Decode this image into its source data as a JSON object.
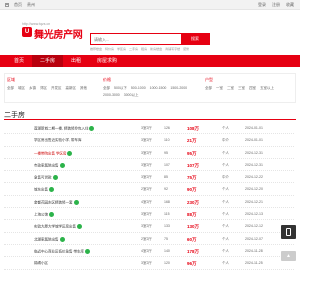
{
  "topbar": {
    "home_label": "首页",
    "site_label": "贵州",
    "links": [
      "登录",
      "注册",
      "收藏"
    ]
  },
  "header": {
    "site_url": "http://www.tqzs.cn",
    "logo_badge": "U",
    "logo_text": "舞光房产网",
    "search_placeholder": "请输入...",
    "search_button": "搜索",
    "hotwords": [
      "推荐楼盘",
      "特价房",
      "学区房",
      "二手房",
      "租房",
      "新房楼盘",
      "商铺写字楼",
      "装修"
    ]
  },
  "nav": {
    "items": [
      "首页",
      "二手房",
      "出租",
      "房屋求购"
    ],
    "active_index": 1
  },
  "filters": [
    {
      "head": "区域",
      "options": [
        "全部",
        "城区",
        "乡镇",
        "郊区",
        "开发区",
        "高新区",
        "其他"
      ]
    },
    {
      "head": "价格",
      "options": [
        "全部",
        "500以下",
        "500-1000",
        "1000-1500",
        "1500-2000",
        "2000-3000",
        "3000以上"
      ]
    },
    {
      "head": "户型",
      "options": [
        "全部",
        "一室",
        "二室",
        "三室",
        "四室",
        "五室以上"
      ]
    }
  ],
  "section_title": "二手房",
  "colors": {
    "brand": "#e60012",
    "price": "#e60012",
    "verified": "#2cb34a"
  },
  "listings": [
    {
      "area": "",
      "title": "莲湖新城二期一楼, 精装修拎包入住",
      "verified": true,
      "room": "3室2厅",
      "size": "126",
      "price": "108万",
      "agent": "个人",
      "date": "2024-01-01",
      "highlight": false
    },
    {
      "area": "",
      "title": "学区房出售近实验小学, 带车库",
      "verified": false,
      "room": "3室2厅",
      "size": "110",
      "price": "21万",
      "agent": "中介",
      "date": "2024-01-01",
      "highlight": false
    },
    {
      "area": "",
      "title": "一楼带院出售 学区房",
      "verified": true,
      "room": "3室2厅",
      "size": "95",
      "price": "95万",
      "agent": "个人",
      "date": "2024-12-31",
      "highlight": true
    },
    {
      "area": "",
      "title": "市政家属院出售",
      "verified": true,
      "room": "3室2厅",
      "size": "107",
      "price": "107万",
      "agent": "个人",
      "date": "2024-12-31",
      "highlight": false
    },
    {
      "area": "",
      "title": "急售可贷款",
      "verified": true,
      "room": "3室2厅",
      "size": "85",
      "price": "75万",
      "agent": "中介",
      "date": "2024-12-22",
      "highlight": false
    },
    {
      "area": "",
      "title": "城东出售",
      "verified": true,
      "room": "2室2厅",
      "size": "92",
      "price": "90万",
      "agent": "个人",
      "date": "2024-12-20",
      "highlight": false
    },
    {
      "area": "",
      "title": "金都花园东区精装修一套",
      "verified": true,
      "room": "4室2厅",
      "size": "168",
      "price": "230万",
      "agent": "个人",
      "date": "2024-12-21",
      "highlight": false
    },
    {
      "area": "",
      "title": "上海公馆",
      "verified": true,
      "room": "3室2厅",
      "size": "115",
      "price": "88万",
      "agent": "个人",
      "date": "2024-12-13",
      "highlight": false
    },
    {
      "area": "",
      "title": "实验大厦大学城学区房出售",
      "verified": true,
      "room": "3室2厅",
      "size": "133",
      "price": "130万",
      "agent": "个人",
      "date": "2024-12-12",
      "highlight": false
    },
    {
      "area": "",
      "title": "北湖家属院出售",
      "verified": true,
      "room": "2室2厅",
      "size": "75",
      "price": "60万",
      "agent": "个人",
      "date": "2024-12-07",
      "highlight": false
    },
    {
      "area": "",
      "title": "临近中心商业区低价急售 带车库",
      "verified": true,
      "room": "4室2厅",
      "size": "140",
      "price": "178万",
      "agent": "个人",
      "date": "2024-11-28",
      "highlight": false
    },
    {
      "area": "",
      "title": "锦绣小区",
      "verified": false,
      "room": "3室2厅",
      "size": "120",
      "price": "96万",
      "agent": "个人",
      "date": "2024-11-25",
      "highlight": false
    }
  ],
  "side": {
    "top_label": "▲"
  }
}
